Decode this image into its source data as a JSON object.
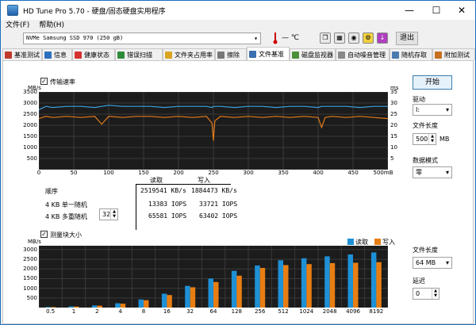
{
  "window": {
    "title": "HD Tune Pro 5.70 - 硬盘/固态硬盘实用程序"
  },
  "menu": {
    "file": "文件(F)",
    "help": "帮助(H)"
  },
  "toolbar": {
    "drive": "NVMe   Samsung SSD 970 (250 gB)",
    "temperature": "— ℃",
    "exit_label": "退出"
  },
  "tabs": [
    {
      "label": "基准测试",
      "color": "#c0392b"
    },
    {
      "label": "信息",
      "color": "#2e6fbf"
    },
    {
      "label": "健康状态",
      "color": "#d63030"
    },
    {
      "label": "错误扫描",
      "color": "#2e8b3a"
    },
    {
      "label": "文件夹占用率",
      "color": "#d9a520"
    },
    {
      "label": "擦除",
      "color": "#777"
    },
    {
      "label": "文件基准",
      "color": "#3a6fb0"
    },
    {
      "label": "磁盘监视器",
      "color": "#4a8f3a"
    },
    {
      "label": "自动噪音管理",
      "color": "#888"
    },
    {
      "label": "随机存取",
      "color": "#4a7ab0"
    },
    {
      "label": "附加测试",
      "color": "#c87020"
    }
  ],
  "transfer": {
    "checkbox_label": "传输速率",
    "unit_left": "MB/s",
    "unit_right": "ms",
    "y_left_ticks": [
      "3500",
      "3000",
      "2500",
      "2000",
      "1500",
      "1000",
      "500"
    ],
    "y_right_ticks": [
      "35",
      "30",
      "25",
      "20",
      "15",
      "10",
      "5"
    ],
    "x_ticks": [
      "0",
      "50",
      "100",
      "150",
      "200",
      "250",
      "300",
      "350",
      "400",
      "450",
      "500mB"
    ]
  },
  "results": {
    "col_read": "读取",
    "col_write": "写入",
    "rows": [
      {
        "label": "顺序",
        "read": "2519541 KB/s",
        "write": "1884473 KB/s"
      },
      {
        "label": "4 KB 单一随机",
        "read": "13383 IOPS",
        "write": "33721 IOPS"
      },
      {
        "label": "4 KB 多重随机",
        "read": "65581 IOPS",
        "write": "63402 IOPS",
        "queue": "32"
      }
    ]
  },
  "blocksize": {
    "checkbox_label": "测量块大小",
    "unit": "MB/s",
    "legend_read": "读取",
    "legend_write": "写入",
    "y_ticks": [
      "3000",
      "2500",
      "2000",
      "1500",
      "1000",
      "500"
    ]
  },
  "side": {
    "start_label": "开始",
    "drive_label": "驱动",
    "drive_value": "I:",
    "file_length_label": "文件长度",
    "file_length_value": "500",
    "file_length_unit": "MB",
    "data_mode_label": "数据模式",
    "data_mode_value": "零",
    "file_length2_label": "文件长度",
    "file_length2_value": "64 MB",
    "delay_label": "延迟",
    "delay_value": "0"
  },
  "colors": {
    "read": "#1e90d6",
    "write": "#e87e12",
    "transfer_read": "#3aa0e0",
    "transfer_write": "#e07a1a"
  },
  "chart_data": [
    {
      "type": "line",
      "xlabel": "",
      "ylabel": "MB/s",
      "xlim": [
        0,
        500
      ],
      "ylim": [
        0,
        3500
      ],
      "x": [
        0,
        10,
        20,
        40,
        60,
        80,
        90,
        100,
        120,
        140,
        160,
        180,
        200,
        220,
        240,
        248,
        250,
        252,
        260,
        280,
        300,
        320,
        340,
        360,
        380,
        400,
        405,
        410,
        420,
        440,
        460,
        480,
        500
      ],
      "series": [
        {
          "name": "读取",
          "values": [
            2700,
            2850,
            2800,
            2850,
            2850,
            2800,
            2850,
            2900,
            2850,
            2850,
            2850,
            2800,
            2850,
            2850,
            2850,
            2800,
            2850,
            2850,
            2850,
            2800,
            2850,
            2850,
            2800,
            2850,
            2850,
            2800,
            2850,
            2850,
            2850,
            2850,
            2800,
            2850,
            2850
          ]
        },
        {
          "name": "写入",
          "values": [
            2300,
            2400,
            2350,
            2400,
            2350,
            2400,
            2050,
            2400,
            2350,
            2400,
            2400,
            2350,
            2400,
            2350,
            2400,
            2100,
            1300,
            2200,
            2400,
            2350,
            2400,
            2350,
            2400,
            2350,
            2400,
            2350,
            1900,
            2350,
            2400,
            2350,
            2400,
            2350,
            2300
          ]
        }
      ]
    },
    {
      "type": "bar",
      "xlabel": "",
      "ylabel": "MB/s",
      "ylim": [
        0,
        3200
      ],
      "categories": [
        "0.5",
        "1",
        "2",
        "4",
        "8",
        "16",
        "32",
        "64",
        "128",
        "256",
        "512",
        "1024",
        "2048",
        "4096",
        "8192"
      ],
      "series": [
        {
          "name": "读取",
          "values": [
            30,
            60,
            110,
            220,
            420,
            720,
            1120,
            1500,
            1900,
            2180,
            2450,
            2550,
            2650,
            2750,
            2850
          ]
        },
        {
          "name": "写入",
          "values": [
            25,
            55,
            100,
            200,
            380,
            650,
            1050,
            1320,
            1650,
            2050,
            2200,
            2250,
            2300,
            2320,
            2350
          ]
        }
      ]
    }
  ]
}
